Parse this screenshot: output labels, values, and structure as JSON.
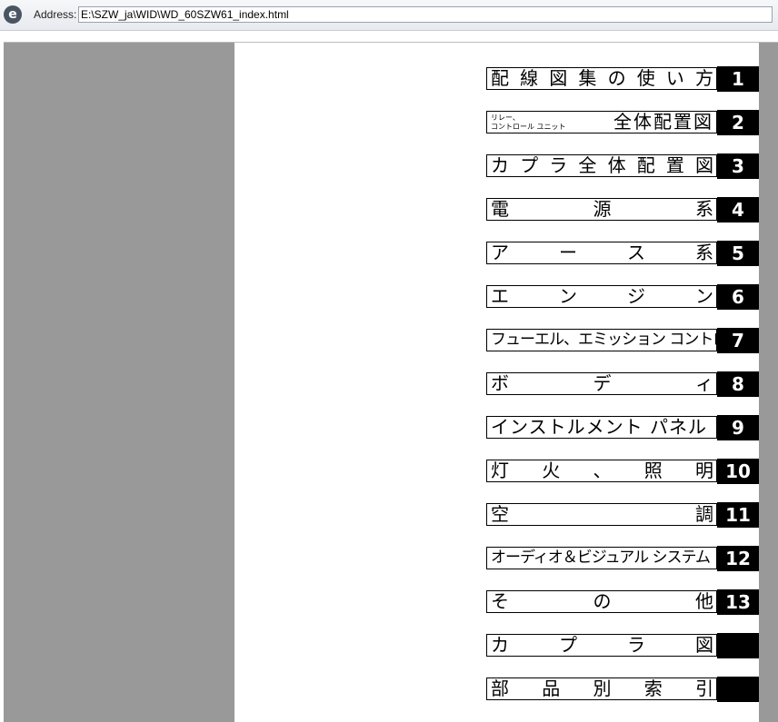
{
  "toolbar": {
    "icon": "ie-browser-icon",
    "address_label": "Address:",
    "address_value": "E:\\SZW_ja\\WID\\WD_60SZW61_index.html"
  },
  "index": [
    {
      "label": "配線図集の使い方",
      "tab": "1"
    },
    {
      "small": "リレー、\nコントロール ユニット",
      "label": "全体配置図",
      "tab": "2"
    },
    {
      "label": "カプラ全体配置図",
      "tab": "3"
    },
    {
      "label": "電源系",
      "tab": "4"
    },
    {
      "label": "アース系",
      "tab": "5"
    },
    {
      "label": "エンジン",
      "tab": "6"
    },
    {
      "label": "フューエル、エミッション コントロール",
      "tab": "7"
    },
    {
      "label": "ボディ",
      "tab": "8"
    },
    {
      "label": "インストルメント パネル",
      "tab": "9"
    },
    {
      "label": "灯火、照明",
      "tab": "10"
    },
    {
      "label": "空調",
      "tab": "11"
    },
    {
      "label": "オーディオ＆ビジュアル システム",
      "tab": "12"
    },
    {
      "label": "その他",
      "tab": "13"
    },
    {
      "label": "カプラ図",
      "tab": ""
    },
    {
      "label": "部品別索引",
      "tab": ""
    }
  ]
}
